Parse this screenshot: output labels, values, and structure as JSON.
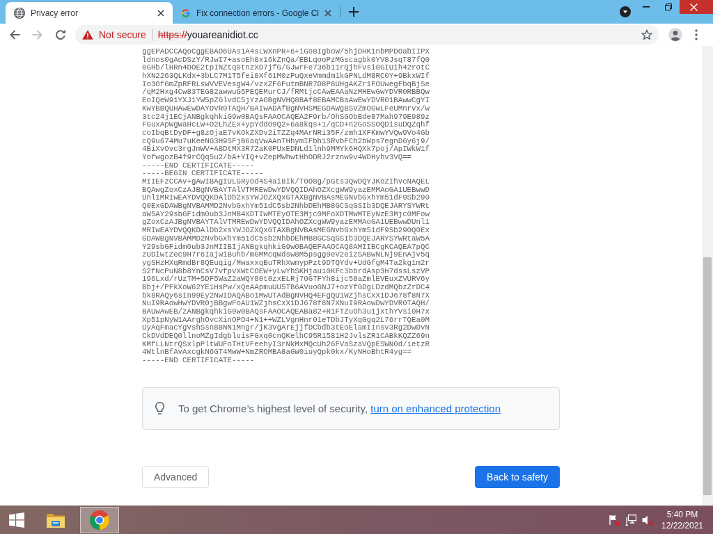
{
  "tabs": [
    {
      "title": "Privacy error",
      "selected": true
    },
    {
      "title": "Fix connection errors - Google Cl",
      "selected": false
    }
  ],
  "navigation": {
    "back_disabled": false,
    "forward_disabled": true
  },
  "address_bar": {
    "secure": false,
    "security_label": "Not secure",
    "scheme": "https://",
    "host": "youareanidiot.cc"
  },
  "certificate_text": [
    "ggEPADCCAQoCggEBAO6UAs1A4sLWXnPR+6+iGo8IgboW/5hjDHK1nbMPDOabIIPX",
    "ldnos0gAcDSzY/RJwI7+asoEh8x16kZnQa/EBLqooPzMGscagbk0YV8JsqT87fQ0",
    "0GHb/lHRn4DOE2tpINZtq0tnzXD7jfG/GJwrFe736b11rQjhFvsi8GIUih42rotC",
    "hXN2263QLKdx+3bLC7M1T5fei8Xf61M0zPuQxeVmmdm1kGPNLdM8RC0Y+9BkxWIf",
    "Io3OfGmZpRFRLsWVVEVesgW4/vzxZF6FutmBNR7D8P8UHgAKZr1FOUwegFbqBjSe",
    "/qM2Hxg4Cw83TEG82awwuG5PEQEMurCJ/fRMtjcCAwEAAaNzMHEwGwYDVR0RBBQw",
    "EoIQeW91YXJ1YW5pZGlvdC5jYzAOBgNVHQ8BAf8EBAMCBaAwEwYDVR01BAwwCgYI",
    "KwYBBQUHAwEwDAYDVR0TAQH/BAIwADAfBgNVHSMEGDAWgBSVZmOGwLFeUMnrvx/w",
    "3tc24j1ECjANBgkqhkiG9w0BAQsFAAOCAQEA2F9rb/OhSGObBde87Mah979E989z",
    "FGuxApWgWaHcLW+O2LhZEx+ypYddO9Q2+6a8kqs+1/qCD+n2GoSSOQDisuDQZqhf",
    "coIbqBtDyDF+g8zOjaE7vKOkZXDv2iTZZq4MArNRi35F/zmh1XFKmwYVQw9Vo4Gb",
    "cQ9u674Mu7uKeeNG3H9SFjB6aqVwAAnTHhymIFbh1SRvbFCh2bWps7egnD6y6j9/",
    "4BiXvOvc3rgJmWV+A8DtMX3R7ZaK0PUxEDNLd1lnh9MMYk6HQXk7poj/ApIWkW1f",
    "YofwgozB4f9rCQq5u2/bA+YIQ+vZepMWhwtHhODRJ2rznw9v4WDHyhv3VQ==",
    "-----END CERTIFICATE-----",
    "-----BEGIN CERTIFICATE-----",
    "MIIEFzCCAv+gAwIBAgIULGRyOd4S4ai8Ik/T0O8g/pGts3QwDQYJKoZIhvcNAQEL",
    "BQAwgZoxCzAJBgNVBAYTAlVTMREwDwYDVQQIDAhOZXcgWW9yazEMMAoGA1UEBwwD",
    "Unl1MRIwEAYDVQQKDAlDb2xsYWJOZXQxGTAXBgNVBAsMEGNvbGxhYm51dF9Sb290",
    "Q0ExGDAWBgNVBAMMD2NvbGxhYm51dC5sb2NhbDEhMB8GCSqGSIb3DQEJARYSYWRt",
    "aW5AY29sbGFidm0ub3JnMB4XDTIwMTEyOTE3Mjc0MFoXDTMwMTEyNzE3Mjc0MFow",
    "gZoxCzAJBgNVBAYTAlVTMREwDwYDVQQIDAhOZXcgWW9yazEMMAoGA1UEBwwDUnl1",
    "MRIwEAYDVQQKDAlDb2xsYWJOZXQxGTAXBgNVBAsMEGNvbGxhYm51dF9Sb290Q0Ex",
    "GDAWBgNVBAMMD2NvbGxhYm51dC5sb2NhbDEhMB8GCSqGSIb3DQEJARYSYWRtaW5A",
    "Y29sbGFidm0ub3JnMIIBIjANBgkqhkiG9w0BAQEFAAOCAQ8AMIIBCgKCAQEA7pQC",
    "zUDiwtZec9H7r6IajwiBuhb/mGMMcqWdsw8M5psgg9eV2eizSABwNLNj9EnAjv5q",
    "ygSHzHXqRmdBr8QEuqig/MwaxxqBuTRhXwmypPzt9DTQYdv+UdGfgM4Ta2kg1m2r",
    "S2fNcPuN8b8YnCsV7vfpvXWtCOEW+yLwYhSKHjaui0KFc3bbrdAsp3H7dssLszVP",
    "196Lxd/rUzTM+5DF5WaZ2aWQY80t0zxELRj70GTFYh8ijc58aZmlEVEuxZVURV6y",
    "Bbj+/PFkXoW62YE1HsPw/xQeAApmuUU5TB6AVuoGNJ7+ozYfGDgLDzdMQbzZrDC4",
    "bk8RAQy6sIn99Ey2NwIDAQABo1MwUTAdBgNVHQ4EFgQU1WZjhsCxX1DJ678f8N7X",
    "NuI9RAowHwYDVR0jBBgwFoAU1WZjhsCxX1DJ678f8N7XNuI9RAowDwYDVR0TAQH/",
    "BAUwAwEB/zANBgkqhkiG9w0BAQsFAAOCAQEABa82+R1FTZuOh3u1jxthYVsi0H7x",
    "Xp51pNyW1AArghOvcXinOPO4+N1++WZLVgnHnr01eTDbJTyXqGgq2L76rrTQEa0M",
    "UyAqFmacYgVshSsn88NN1Mngr/jK3VgArEjjfDCbdb3tEoElamIInsv3Rg2DwDvN",
    "CkDVdDEQ0llnoMZgIdgbluisFGxq0cnQKelhC95R1581H2JvlsZR1CABkKQZZ69n",
    "KMfLLNtrQSxlpPltWUFoTHtVFeehyI3rNkMxMQcUh26FVaSzaVQpESWN0d/ietzR",
    "4WtlnBfAvAxcgkN6GT4MwW+NmZROMBA8aGW0iuyQpk0kx/KyNHoBhtR4yg==",
    "-----END CERTIFICATE-----"
  ],
  "security_tip": {
    "text": "To get Chrome’s highest level of security,",
    "link": "turn on enhanced protection"
  },
  "buttons": [
    {
      "label": "Advanced",
      "kind": "outlined"
    },
    {
      "label": "Back to safety",
      "kind": "filled"
    }
  ],
  "taskbar": {
    "apps": [
      {
        "selected": false
      },
      {
        "selected": true
      }
    ],
    "time": "5:40 PM",
    "date": "12/22/2021"
  }
}
